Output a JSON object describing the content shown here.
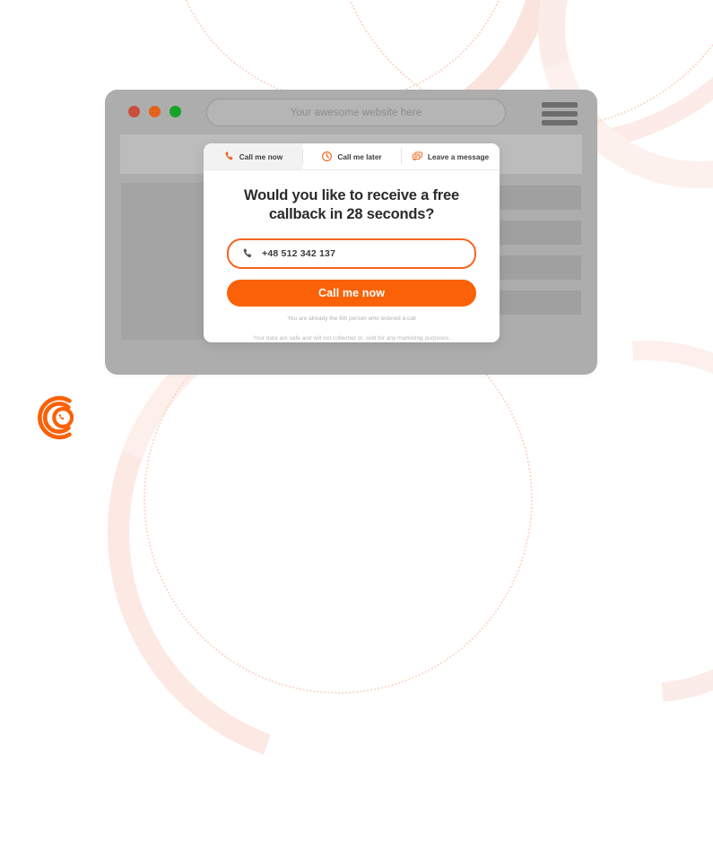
{
  "colors": {
    "accent": "#fb6107",
    "accent_border": "#f26522",
    "browser_frame": "#adadad",
    "page_bg": "#ffffff",
    "text_dark": "#2b2b2b",
    "muted": "#b0b0b0"
  },
  "browser": {
    "traffic_lights": [
      {
        "name": "close-dot",
        "color": "#c94f3d"
      },
      {
        "name": "minimize-dot",
        "color": "#e8641c"
      },
      {
        "name": "maximize-dot",
        "color": "#16a427"
      }
    ],
    "url_placeholder": "Your awesome website here",
    "menu_icon": "hamburger-icon"
  },
  "widget": {
    "tabs": [
      {
        "label": "Call me now",
        "icon": "phone-icon",
        "active": true
      },
      {
        "label": "Call me later",
        "icon": "clock-icon",
        "active": false
      },
      {
        "label": "Leave a message",
        "icon": "chat-icon",
        "active": false
      }
    ],
    "headline": "Would you like to receive a free callback in 28 seconds?",
    "headline_line1": "Would you like to receive a free",
    "headline_line2": "callback in 28 seconds?",
    "seconds": 28,
    "phone": {
      "icon": "phone-handset-icon",
      "value": "+48 512 342 137",
      "placeholder": "+48 512 342 137"
    },
    "cta_label": "Call me now",
    "social_proof": "You are already the 6th person who ordered a call",
    "privacy_note": "Your data are safe and will not collected or, sold for any marketing purposes."
  },
  "logo": {
    "name": "callback-logo",
    "color": "#fb6107"
  }
}
